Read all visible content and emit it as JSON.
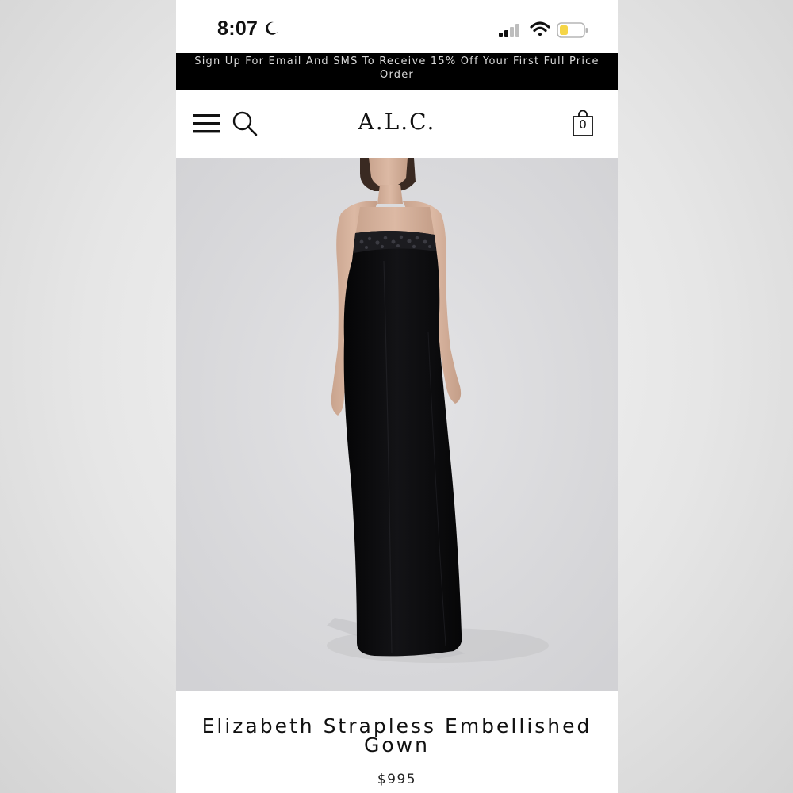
{
  "status_bar": {
    "time": "8:07",
    "icons": [
      "moon-icon",
      "cellular-signal-icon",
      "wifi-icon",
      "battery-icon"
    ],
    "battery_color": "#f5d547"
  },
  "promo_banner": {
    "text": "Sign Up For Email And SMS To Receive 15% Off Your First Full Price Order"
  },
  "header": {
    "logo": "A.L.C.",
    "menu_icon": "hamburger-menu-icon",
    "search_icon": "search-icon",
    "bag_icon": "shopping-bag-icon",
    "bag_count": "0"
  },
  "product": {
    "image_description_icon": "model-in-black-gown-image",
    "name": "Elizabeth Strapless Embellished Gown",
    "price": "$995"
  },
  "colors": {
    "banner_bg": "#000000",
    "banner_text": "#d8d8d8",
    "image_bg": "#dcdcde",
    "gown": "#0d0d0f"
  }
}
